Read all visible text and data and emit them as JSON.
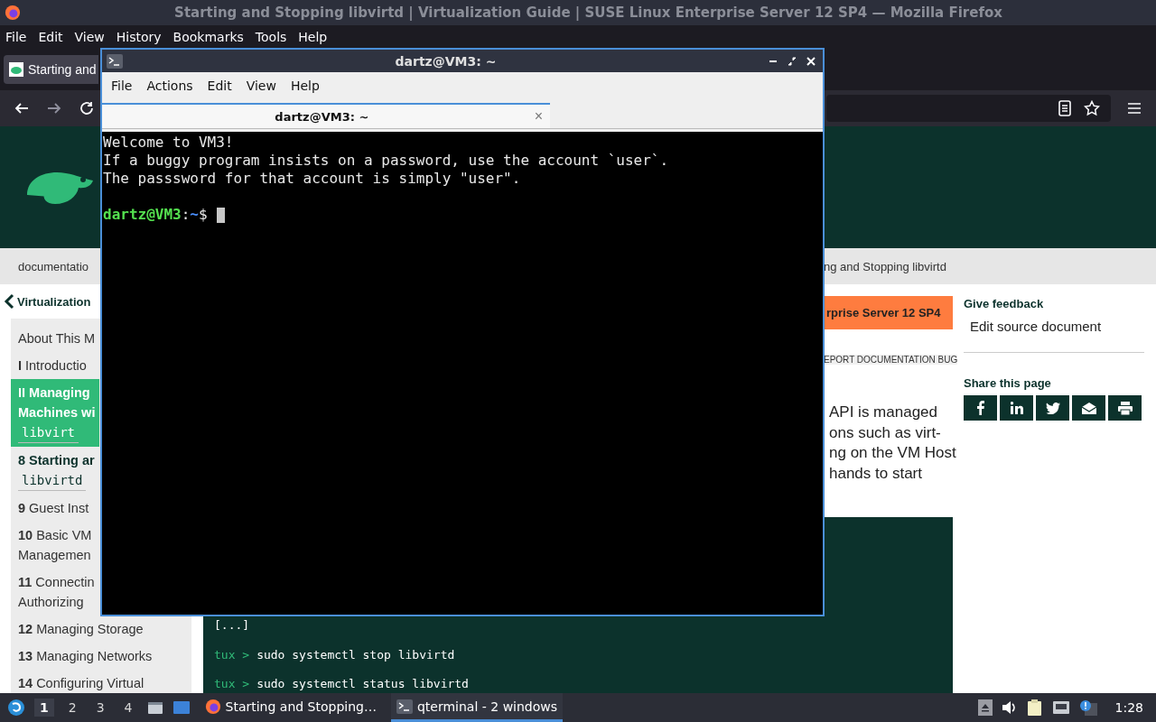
{
  "browser": {
    "title": "Starting and Stopping libvirtd | Virtualization Guide | SUSE Linux Enterprise Server 12 SP4 — Mozilla Firefox",
    "menu": [
      "File",
      "Edit",
      "View",
      "History",
      "Bookmarks",
      "Tools",
      "Help"
    ],
    "tab": {
      "label": "Starting and"
    },
    "breadcrumb": {
      "start": "documentatio",
      "end": "ng and Stopping libvirtd"
    }
  },
  "sidebar": {
    "heading": "Virtualization",
    "items": [
      {
        "lines": [
          "About This M"
        ],
        "selected": false,
        "current": false
      },
      {
        "number": "I",
        "lines": [
          "Introductio"
        ],
        "selected": false,
        "current": false
      },
      {
        "number": "II",
        "lines": [
          "Managing",
          "Machines wi"
        ],
        "code": "libvirt",
        "selected": true,
        "current": false
      },
      {
        "number": "8",
        "lines": [
          "Starting ar"
        ],
        "code": "libvirtd",
        "selected": false,
        "current": true
      },
      {
        "number": "9",
        "lines": [
          "Guest Inst"
        ],
        "selected": false,
        "current": false
      },
      {
        "number": "10",
        "lines": [
          "Basic VM",
          "Managemen"
        ],
        "selected": false,
        "current": false
      },
      {
        "number": "11",
        "lines": [
          "Connectin",
          "Authorizing"
        ],
        "selected": false,
        "current": false
      },
      {
        "number": "12",
        "lines": [
          "Managing Storage"
        ],
        "selected": false,
        "current": false
      },
      {
        "number": "13",
        "lines": [
          "Managing Networks"
        ],
        "selected": false,
        "current": false
      },
      {
        "number": "14",
        "lines": [
          "Configuring Virtual"
        ],
        "selected": false,
        "current": false
      }
    ]
  },
  "article": {
    "product_banner": "rprise Server 12 SP4",
    "report_link": "EPORT DOCUMENTATION BUG",
    "paragraph_lines": [
      "API is managed",
      "ons such as virt-",
      "ng on the VM Host",
      "hands to start"
    ],
    "code_lines": [
      {
        "command": "[...]"
      },
      {
        "prompt": "tux >",
        "command": "sudo systemctl stop libvirtd"
      },
      {
        "prompt": "tux >",
        "command": "sudo systemctl status libvirtd"
      }
    ]
  },
  "aside": {
    "feedback_heading": "Give feedback",
    "edit_link": "Edit source document",
    "share_heading": "Share this page",
    "share_buttons": [
      {
        "kind": "facebook"
      },
      {
        "kind": "linkedin"
      },
      {
        "kind": "twitter"
      },
      {
        "kind": "mail"
      },
      {
        "kind": "print"
      }
    ]
  },
  "terminal": {
    "title": "dartz@VM3: ~",
    "menu": [
      "File",
      "Actions",
      "Edit",
      "View",
      "Help"
    ],
    "tab": {
      "label": "dartz@VM3: ~",
      "close": "×"
    },
    "output": [
      "Welcome to VM3!",
      "If a buggy program insists on a password, use the account `user`.",
      "The passsword for that account is simply \"user\"."
    ],
    "prompt": {
      "user_host": "dartz@VM3",
      "separator": ":",
      "path": "~",
      "symbol": "$"
    }
  },
  "taskbar": {
    "workspaces": [
      {
        "label": "1",
        "selected": true
      },
      {
        "label": "2",
        "selected": false
      },
      {
        "label": "3",
        "selected": false
      },
      {
        "label": "4",
        "selected": false
      }
    ],
    "tasks": [
      {
        "kind": "firefox",
        "label": "Starting and Stopping…",
        "selected": false
      },
      {
        "kind": "terminal",
        "label": "qterminal - 2 windows",
        "selected": true
      }
    ],
    "clock": "1:28"
  }
}
